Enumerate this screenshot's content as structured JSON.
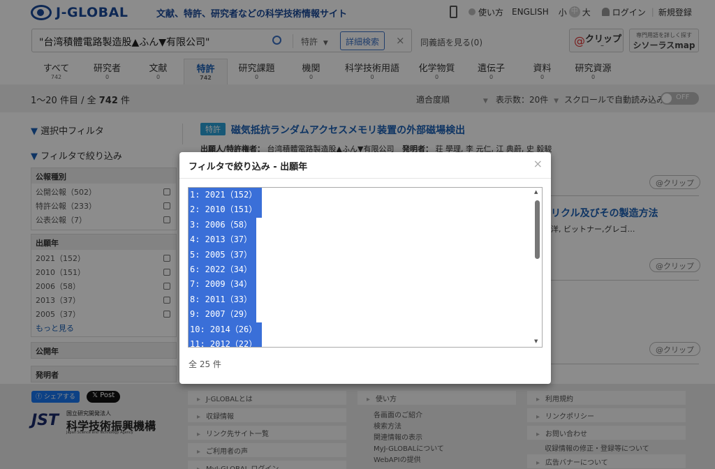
{
  "header": {
    "logo": "J-GLOBAL",
    "tagline": "文献、特許、研究者などの科学技術情報サイト",
    "howto": "使い方",
    "english": "ENGLISH",
    "font_small": "小",
    "font_mid": "中",
    "font_large": "大",
    "login": "ログイン",
    "register": "新規登録"
  },
  "search": {
    "value": "\"台湾積體電路製造股▲ふん▼有限公司\"",
    "category": "特許",
    "advanced": "詳細検索",
    "synonyms": "同義語を見る(0)",
    "clip_label": "クリップ",
    "clip_count": "–",
    "thesaurus_small": "専門用語を詳しく探す",
    "thesaurus": "シソーラスmap"
  },
  "tabs": [
    {
      "label": "すべて",
      "count": "742"
    },
    {
      "label": "研究者",
      "count": "0"
    },
    {
      "label": "文献",
      "count": "0"
    },
    {
      "label": "特許",
      "count": "742"
    },
    {
      "label": "研究課題",
      "count": "0"
    },
    {
      "label": "機関",
      "count": "0"
    },
    {
      "label": "科学技術用語",
      "count": "0"
    },
    {
      "label": "化学物質",
      "count": "0"
    },
    {
      "label": "遺伝子",
      "count": "0"
    },
    {
      "label": "資料",
      "count": "0"
    },
    {
      "label": "研究資源",
      "count": "0"
    }
  ],
  "results": {
    "range": "1～20 件目 / 全",
    "total": "742",
    "unit": "件",
    "sort": "適合度順",
    "per_page": "表示数：20件",
    "autoload": "スクロールで自動読み込み",
    "toggle": "OFF"
  },
  "sidebar": {
    "selected_filter": "選択中フィルタ",
    "narrow": "フィルタで絞り込み",
    "section1": "公報種別",
    "section1_items": [
      "公開公報（502）",
      "特許公報（233）",
      "公表公報（7）"
    ],
    "section2": "出願年",
    "section2_items": [
      "2021（152）",
      "2010（151）",
      "2006（58）",
      "2013（37）",
      "2005（37）"
    ],
    "more": "もっと見る",
    "section3": "公開年",
    "section4": "発明者"
  },
  "result1": {
    "badge": "特許",
    "title": "磁気抵抗ランダムアクセスメモリ装置の外部磁場検出",
    "applicant_label": "出願人/特許権者：",
    "applicant": "台湾積體電路製造股▲ふん▼有限公司",
    "inventor_label": "発明者：",
    "inventor": "荘 學理, 李 元仁, 江 典蔚, 史 毅駿"
  },
  "result2": {
    "title_tail": "リクル及びその製造方法",
    "meta_tail": "洋, ビットナー,グレゴ…"
  },
  "clip_button": "クリップ",
  "modal": {
    "title": "フィルタで絞り込み - 出願年",
    "close": "×",
    "options": [
      "1:  2021（152）",
      "2:  2010（151）",
      "3:  2006（58）",
      "4:  2013（37）",
      "5:  2005（37）",
      "6:  2022（34）",
      "7:  2009（34）",
      "8:  2011（33）",
      "9:  2007（29）",
      "10:  2014（26）",
      "11:  2012（22）"
    ],
    "total": "全 25 件"
  },
  "footer": {
    "share": "シェアする",
    "post": "Post",
    "org_small": "国立研究開発法人",
    "org": "科学技術振興機構",
    "org_en": "Japan Science and Technology Agency",
    "col1": [
      "J-GLOBALとは",
      "収録情報",
      "リンク先サイト一覧",
      "ご利用者の声",
      "MyJ-GLOBAL ログイン"
    ],
    "col2_head": "使い方",
    "col2": [
      "各画面のご紹介",
      "検索方法",
      "関連情報の表示",
      "MyJ-GLOBALについて",
      "WebAPIの提供"
    ],
    "col3": [
      "利用規約",
      "リンクポリシー",
      "お問い合わせ",
      "広告バナーについて"
    ],
    "col3_sub": "収録情報の修正・登録等について"
  }
}
